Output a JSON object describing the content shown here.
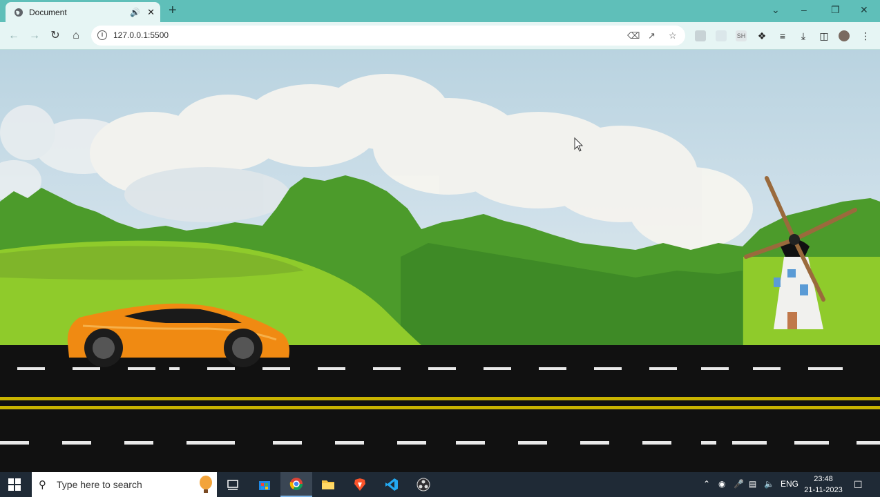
{
  "browser": {
    "tab_title": "Document",
    "url": "127.0.0.1:5500",
    "ext_label": "SH"
  },
  "taskbar": {
    "search_placeholder": "Type here to search",
    "language": "ENG",
    "time": "23:48",
    "date": "21-11-2023"
  },
  "colors": {
    "titlebar": "#5fbfb9",
    "toolbar": "#e6f5f4",
    "road": "#111111",
    "road_lane_yellow": "#c9b400",
    "car_orange": "#f08a12",
    "grass_light": "#8fcb2b",
    "trees": "#4d9a2a"
  },
  "icons": [
    "globe-icon",
    "speaker-icon",
    "close-icon",
    "plus-icon",
    "back-icon",
    "forward-icon",
    "reload-icon",
    "home-icon",
    "info-icon",
    "translate-icon",
    "share-icon",
    "star-icon",
    "extensions-icon",
    "reading-list-icon",
    "download-icon",
    "side-panel-icon",
    "profile-icon",
    "menu-icon",
    "windows-start-icon",
    "search-icon",
    "task-view-icon",
    "store-icon",
    "chrome-icon",
    "file-explorer-icon",
    "brave-icon",
    "vscode-icon",
    "obs-icon"
  ]
}
